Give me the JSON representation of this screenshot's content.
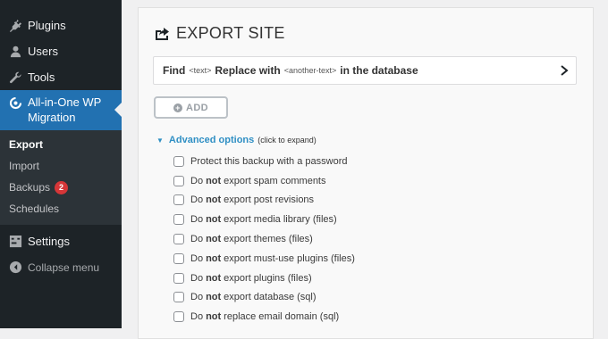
{
  "sidebar": {
    "items_top": [
      {
        "label": "Plugins",
        "icon": "plugins-icon"
      },
      {
        "label": "Users",
        "icon": "users-icon"
      },
      {
        "label": "Tools",
        "icon": "tools-icon"
      }
    ],
    "current": {
      "label_line1": "All-in-One WP",
      "label_line2": "Migration",
      "icon": "aiowpm-logo-icon"
    },
    "submenu": [
      {
        "label": "Export",
        "active": true
      },
      {
        "label": "Import"
      },
      {
        "label": "Backups",
        "badge": "2"
      },
      {
        "label": "Schedules"
      }
    ],
    "settings_label": "Settings",
    "collapse_label": "Collapse menu"
  },
  "main": {
    "title": "EXPORT SITE",
    "find": {
      "find_word": "Find",
      "find_placeholder": "<text>",
      "replace_word": "Replace with",
      "replace_placeholder": "<another-text>",
      "suffix": "in the database"
    },
    "add_label": "ADD",
    "advanced": {
      "label": "Advanced options",
      "hint": "(click to expand)"
    },
    "options": [
      {
        "pre": "",
        "bold": "",
        "text": "Protect this backup with a password"
      },
      {
        "pre": "Do",
        "bold": "not",
        "text": "export spam comments"
      },
      {
        "pre": "Do",
        "bold": "not",
        "text": "export post revisions"
      },
      {
        "pre": "Do",
        "bold": "not",
        "text": "export media library (files)"
      },
      {
        "pre": "Do",
        "bold": "not",
        "text": "export themes (files)"
      },
      {
        "pre": "Do",
        "bold": "not",
        "text": "export must-use plugins (files)"
      },
      {
        "pre": "Do",
        "bold": "not",
        "text": "export plugins (files)"
      },
      {
        "pre": "Do",
        "bold": "not",
        "text": "export database (sql)"
      },
      {
        "pre": "Do",
        "bold": "not",
        "text": "replace email domain (sql)"
      }
    ]
  },
  "colors": {
    "sidebar_bg": "#1d2327",
    "current_bg": "#2271b1",
    "link_blue": "#2f8fc4",
    "badge_red": "#d63638"
  }
}
